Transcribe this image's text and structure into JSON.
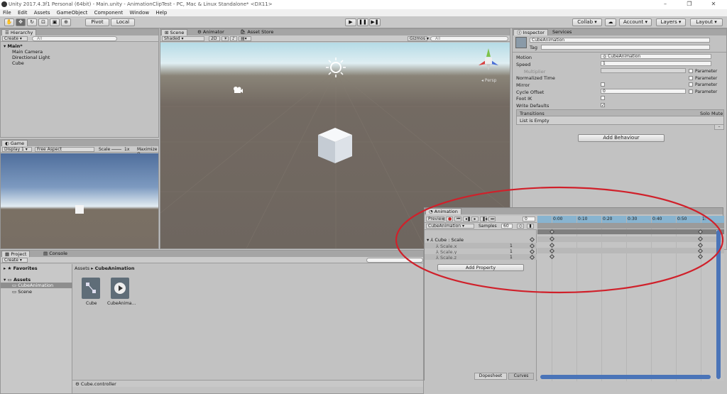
{
  "window": {
    "title": "Unity 2017.4.3f1 Personal (64bit) - Main.unity - AnimationClipTest - PC, Mac & Linux Standalone* <DX11>",
    "min": "–",
    "max": "❐",
    "close": "✕"
  },
  "menu": [
    "File",
    "Edit",
    "Assets",
    "GameObject",
    "Component",
    "Window",
    "Help"
  ],
  "toolbar": {
    "pivot": "Pivot",
    "local": "Local",
    "collab": "Collab ▾",
    "account": "Account ▾",
    "layers": "Layers ▾",
    "layout": "Layout ▾"
  },
  "hierarchy": {
    "tab": "Hierarchy",
    "create": "Create ▾",
    "search_placeholder": "All",
    "scene": "Main*",
    "items": [
      "Main Camera",
      "Directional Light",
      "Cube"
    ]
  },
  "scene_view": {
    "tabs": [
      "Scene",
      "Animator",
      "Asset Store"
    ],
    "shading": "Shaded ▾",
    "mode2d": "2D",
    "gizmos": "Gizmos ▾",
    "search_placeholder": "All",
    "persp": "Persp"
  },
  "game_view": {
    "tab": "Game",
    "display": "Display 1 ▾",
    "aspect": "Free Aspect",
    "scale": "Scale",
    "scale_value": "1x",
    "maximize": "Maximize O"
  },
  "project": {
    "tabs": [
      "Project",
      "Console"
    ],
    "create": "Create ▾",
    "favorites": "Favorites",
    "assets": "Assets",
    "folders": [
      "CubeAnimation",
      "Scene"
    ],
    "breadcrumb_root": "Assets",
    "breadcrumb_child": "CubeAnimation",
    "files": [
      "Cube",
      "CubeAnima..."
    ],
    "footer": "Cube.controller"
  },
  "inspector": {
    "tabs": [
      "Inspector",
      "Services"
    ],
    "name": "CubeAnimation",
    "tag_label": "Tag",
    "rows": [
      {
        "label": "Motion",
        "value": "CubeAnimation"
      },
      {
        "label": "Speed",
        "value": "1"
      },
      {
        "label": "Multiplier",
        "value": ""
      },
      {
        "label": "Normalized Time",
        "value": ""
      },
      {
        "label": "Mirror",
        "value": ""
      },
      {
        "label": "Cycle Offset",
        "value": "0"
      },
      {
        "label": "Foot IK",
        "value": ""
      },
      {
        "label": "Write Defaults",
        "value": "✓"
      }
    ],
    "parameter": "Parameter",
    "transitions": "Transitions",
    "solo_mute": "Solo Mute",
    "list_empty": "List is Empty",
    "add_behaviour": "Add Behaviour"
  },
  "animation": {
    "tab": "Animation",
    "preview": "Preview",
    "frame": "0",
    "clip": "CubeAnimation ▾",
    "samples_label": "Samples",
    "samples": "60",
    "property_group": "Cube : Scale",
    "properties": [
      {
        "name": "Scale.x",
        "value": "1"
      },
      {
        "name": "Scale.y",
        "value": "1"
      },
      {
        "name": "Scale.z",
        "value": "1"
      }
    ],
    "add_property": "Add Property",
    "timeline_labels": [
      "0:00",
      "0:10",
      "0:20",
      "0:30",
      "0:40",
      "0:50",
      "1:"
    ],
    "dopesheet": "Dopesheet",
    "curves": "Curves"
  },
  "colors": {
    "highlight_circle": "#d0202a",
    "selection": "#3d6fb4",
    "timeline_ruler": "#88b4d0"
  }
}
